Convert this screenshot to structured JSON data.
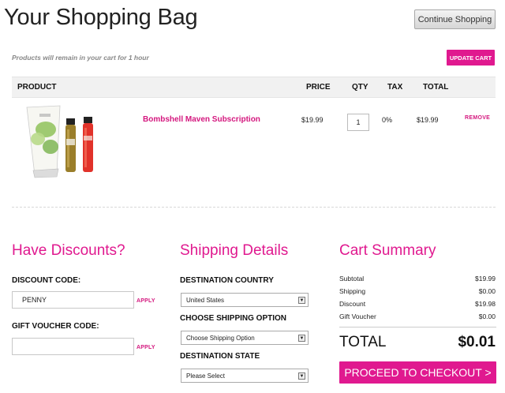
{
  "header": {
    "title": "Your Shopping Bag",
    "continue_label": "Continue Shopping"
  },
  "cart": {
    "note": "Products will remain in your cart for 1 hour",
    "update_label": "UPDATE CART",
    "columns": {
      "product": "PRODUCT",
      "price": "PRICE",
      "qty": "QTY",
      "tax": "TAX",
      "total": "TOTAL"
    },
    "items": [
      {
        "name": "Bombshell Maven Subscription",
        "price": "$19.99",
        "qty": "1",
        "tax": "0%",
        "total": "$19.99",
        "remove_label": "REMOVE"
      }
    ]
  },
  "discounts": {
    "title": "Have Discounts?",
    "discount_label": "DISCOUNT CODE:",
    "discount_value": "PENNY",
    "voucher_label": "GIFT VOUCHER CODE:",
    "voucher_value": "",
    "apply_label": "APPLY"
  },
  "shipping": {
    "title": "Shipping Details",
    "country_label": "DESTINATION COUNTRY",
    "country_value": "United States",
    "option_label": "CHOOSE SHIPPING OPTION",
    "option_value": "Choose Shipping Option",
    "state_label": "DESTINATION STATE",
    "state_value": "Please Select"
  },
  "summary": {
    "title": "Cart Summary",
    "rows": [
      {
        "label": "Subtotal",
        "value": "$19.99"
      },
      {
        "label": "Shipping",
        "value": "$0.00"
      },
      {
        "label": "Discount",
        "value": "$19.98"
      },
      {
        "label": "Gift Voucher",
        "value": "$0.00"
      }
    ],
    "total_label": "TOTAL",
    "total_value": "$0.01",
    "checkout_label": "PROCEED TO CHECKOUT >"
  },
  "colors": {
    "accent": "#e0198f",
    "header_bg": "#f1f1f1"
  },
  "icons": {
    "select_arrow": "chevron-down-icon"
  }
}
